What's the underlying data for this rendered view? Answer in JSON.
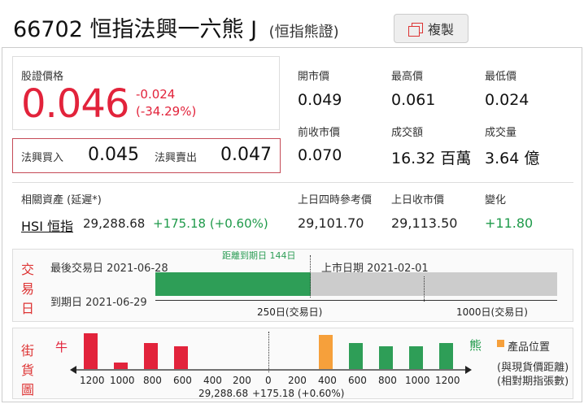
{
  "header": {
    "code": "66702",
    "name": "恒指法興一六熊 J",
    "type": "(恒指熊證)",
    "copy_label": "複製"
  },
  "quote": {
    "price_label": "股證價格",
    "price": "0.046",
    "change": "-0.024",
    "change_pct": "(-34.29%)",
    "bid_label": "法興買入",
    "bid": "0.045",
    "ask_label": "法興賣出",
    "ask": "0.047",
    "stats": [
      {
        "label": "開市價",
        "value": "0.049"
      },
      {
        "label": "最高價",
        "value": "0.061"
      },
      {
        "label": "最低價",
        "value": "0.024"
      },
      {
        "label": "前收市價",
        "value": "0.070"
      },
      {
        "label": "成交額",
        "value": "16.32 百萬"
      },
      {
        "label": "成交量",
        "value": "3.64 億"
      }
    ]
  },
  "underlying": {
    "label": "相關資產 (延遲*)",
    "name": "HSI 恒指",
    "price": "29,288.68",
    "change": "+175.18 (+0.60%)",
    "ref_label": "上日四時參考價",
    "ref_value": "29,101.70",
    "prev_close_label": "上日收市價",
    "prev_close_value": "29,113.50",
    "diff_label": "變化",
    "diff_value": "+11.80"
  },
  "trading_days": {
    "section_label": [
      "交",
      "易",
      "日"
    ],
    "days_to_expiry": "距離到期日 144日",
    "last_trade": "最後交易日 2021-06-28",
    "listing": "上市日期 2021-02-01",
    "expiry": "到期日 2021-06-29",
    "scale_250": "250日(交易日)",
    "scale_1000": "1000日(交易日)",
    "colors": {
      "elapsed": "#2e9e57",
      "remaining": "#cccccc"
    }
  },
  "street_stock": {
    "section_label": [
      "街",
      "貨",
      "圖"
    ],
    "bull_label": "牛",
    "bear_label": "熊",
    "legend_label": "產品位置",
    "note_1": "(與現貨價距離)",
    "note_2": "(相對期指張數)",
    "center_value": "29,288.68",
    "center_change": "+175.18 (+0.60%)",
    "ticks": [
      "1200",
      "1000",
      "800",
      "600",
      "400",
      "200",
      "0",
      "200",
      "400",
      "600",
      "800",
      "1000",
      "1200"
    ],
    "colors": {
      "bull": "#e2233b",
      "bear": "#2e9e57",
      "product": "#f6a03b"
    }
  }
}
